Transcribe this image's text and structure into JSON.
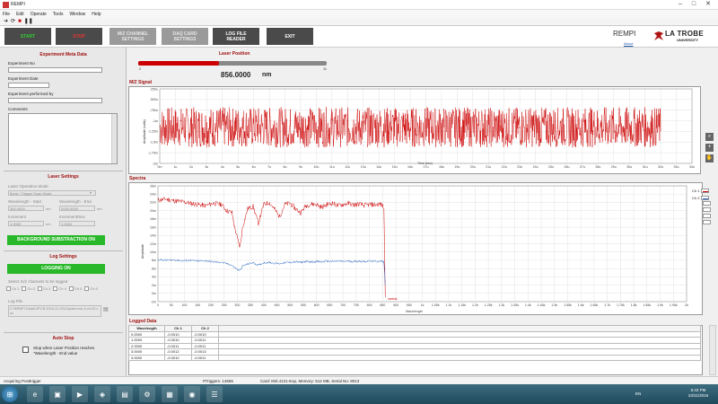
{
  "window": {
    "title": "REMPI",
    "min": "–",
    "max": "□",
    "close": "✕"
  },
  "menu": [
    "File",
    "Edit",
    "Operate",
    "Tools",
    "Window",
    "Help"
  ],
  "toolbar_icons": [
    "➜",
    "⟳",
    "■",
    "❚❚"
  ],
  "top_buttons": {
    "start": "START",
    "stop": "STOP",
    "mz": "M/Z CHANNEL\nSETTINGS",
    "daq": "DAQ CARD\nSETTINGS",
    "logfile": "LOG FILE\nREADER",
    "exit": "EXIT"
  },
  "brand": {
    "app": "REMPI",
    "about": "About",
    "logo_top": "LA TROBE",
    "logo_bottom": "UNIVERSITY"
  },
  "left": {
    "meta_title": "Experiment Meta Data",
    "exp_no": "Experiment No",
    "exp_date": "Experiment Date",
    "exp_by": "Experiment performed by",
    "comments": "Comments",
    "laser_title": "Laser Settings",
    "laser_mode_label": "Laser Operation Mode",
    "laser_mode_value": "Burst / Trigger Scan Mode",
    "wl_start_label": "Wavelength - Start",
    "wl_end_label": "Wavelength - End",
    "wl_start": "300.0000",
    "wl_end": "2000.0000",
    "nm": "nm",
    "inc_label": "Increment",
    "inc_sec_label": "Increment/Sec",
    "inc": "1.0000",
    "inc_sec": "1.0000",
    "bg_btn": "BACKGROUND SUBSTRACTION ON",
    "log_title": "Log Settings",
    "logging_btn": "LOGGING ON",
    "select_ch_label": "Select m/z channels to be logged",
    "channels": [
      "Ch 1",
      "Ch 2",
      "Ch 3",
      "Ch 4",
      "Ch 5",
      "Ch 6"
    ],
    "logfile_label": "Log File",
    "logfile_path": "C:\\REMPI Data\\LZPCB 2016-11-23\\12pulse-nov-4-ch-02.csv",
    "auto_title": "Auto Stop",
    "auto_text": "Stop when Laser Position reaches \"Wavelength - End value"
  },
  "laser": {
    "title": "Laser Position",
    "value": "856.0000",
    "unit": "nm",
    "min_label": "0",
    "max_label": "2k",
    "fraction": 0.428
  },
  "mz": {
    "title": "M/Z Signal",
    "ylabel": "Amplitude (volts)",
    "xlabel": "Time (sec)",
    "yticks": [
      "-250u",
      "-500u",
      "-750u",
      "-1m",
      "-1.25m",
      "-1.5m",
      "-1.75m",
      "-2m"
    ],
    "xticks": [
      "0m",
      "1u",
      "2u",
      "3u",
      "4u",
      "5u",
      "6u",
      "7u",
      "8u",
      "9u",
      "10u",
      "11u",
      "12u",
      "13u",
      "14u",
      "15u",
      "16u",
      "17u",
      "18u",
      "19u",
      "20u",
      "21u",
      "22u",
      "23u",
      "24u",
      "25u",
      "26u",
      "27u",
      "28u",
      "29u",
      "30u",
      "31u",
      "32u",
      "33u",
      "34u"
    ]
  },
  "spectra": {
    "title": "Spectra",
    "ylabel": "Amplitude",
    "xlabel": "Wavelength",
    "yticks": [
      "26m",
      "24m",
      "22m",
      "20m",
      "18m",
      "16m",
      "14m",
      "12m",
      "10m",
      "8m",
      "6m",
      "4m",
      "2m",
      "0m",
      "-2m"
    ],
    "xticks": [
      "0",
      "50",
      "100",
      "150",
      "200",
      "250",
      "300",
      "350",
      "400",
      "450",
      "500",
      "550",
      "600",
      "650",
      "700",
      "750",
      "800",
      "850",
      "900",
      "950",
      "1k",
      "1.05k",
      "1.1k",
      "1.15k",
      "1.2k",
      "1.25k",
      "1.3k",
      "1.35k",
      "1.4k",
      "1.45k",
      "1.5k",
      "1.55k",
      "1.6k",
      "1.65k",
      "1.7k",
      "1.75k",
      "1.8k",
      "1.85k",
      "1.9k",
      "1.95k",
      "2k"
    ],
    "legend": [
      "Ch 1",
      "Ch 2"
    ],
    "marker_label": "lumbak"
  },
  "chart_data": [
    {
      "type": "line",
      "title": "M/Z Signal",
      "xlabel": "Time (sec)",
      "ylabel": "Amplitude (volts)",
      "xlim": [
        0,
        34
      ],
      "ylim": [
        -0.002,
        -0.00025
      ],
      "series": [
        {
          "values_mean": -0.00115,
          "values_span": [
            -0.0016,
            -0.00065
          ]
        }
      ]
    },
    {
      "type": "line",
      "title": "Spectra",
      "xlabel": "Wavelength",
      "ylabel": "Amplitude",
      "xlim": [
        0,
        2000
      ],
      "ylim": [
        -0.002,
        0.026
      ],
      "x": [
        0,
        30,
        60,
        90,
        120,
        150,
        180,
        210,
        240,
        260,
        280,
        290,
        300,
        310,
        320,
        340,
        360,
        380,
        400,
        420,
        440,
        460,
        480,
        500,
        520,
        540,
        560,
        580,
        600,
        620,
        640,
        660,
        680,
        700,
        720,
        740,
        760,
        780,
        800,
        820,
        840,
        850,
        855,
        860
      ],
      "series": [
        {
          "name": "Ch 1",
          "values": [
            0.0225,
            0.0228,
            0.0224,
            0.0222,
            0.0218,
            0.0215,
            0.0212,
            0.0218,
            0.0215,
            0.02,
            0.0195,
            0.016,
            0.0135,
            0.011,
            0.016,
            0.0205,
            0.021,
            0.017,
            0.0215,
            0.022,
            0.0205,
            0.0185,
            0.0215,
            0.0218,
            0.0205,
            0.0195,
            0.0212,
            0.0216,
            0.0215,
            0.0208,
            0.0215,
            0.0218,
            0.0212,
            0.0215,
            0.0218,
            0.0214,
            0.0216,
            0.0213,
            0.0215,
            0.0214,
            0.0216,
            0.0212,
            0.0205,
            -0.001
          ]
        },
        {
          "name": "Ch 2",
          "values": [
            0.0082,
            0.008,
            0.0081,
            0.0079,
            0.008,
            0.0078,
            0.0079,
            0.0076,
            0.0075,
            0.0072,
            0.0068,
            0.0062,
            0.0058,
            0.0055,
            0.0066,
            0.0071,
            0.0074,
            0.0068,
            0.0074,
            0.0075,
            0.0073,
            0.0072,
            0.0074,
            0.0075,
            0.0076,
            0.0075,
            0.0077,
            0.0076,
            0.0077,
            0.0076,
            0.0078,
            0.0077,
            0.0078,
            0.0077,
            0.0078,
            0.0077,
            0.0078,
            0.0077,
            0.0078,
            0.0077,
            0.0078,
            0.0077,
            0.0076,
            0.002
          ]
        }
      ],
      "legend": "right"
    }
  ],
  "logged": {
    "title": "Logged Data",
    "headers": [
      "Wavelength",
      "Ch 1",
      "Ch 2"
    ],
    "rows": [
      [
        "0.0000",
        "-0.0010",
        "-0.0010"
      ],
      [
        "1.0000",
        "-0.0010",
        "-0.0011"
      ],
      [
        "2.0000",
        "-0.0011",
        "-0.0011"
      ],
      [
        "3.0000",
        "-0.0012",
        "-0.0013"
      ],
      [
        "4.0000",
        "-0.0010",
        "-0.0011"
      ]
    ]
  },
  "status": {
    "left": "Acquiring Posttrigger",
    "triggers": "#Triggers: 14555",
    "card": "Card: M3i.4121-Exp, Memory: 512 MB, Serial No: 8013"
  },
  "taskbar": {
    "lang": "EN",
    "time": "5:43 PM",
    "date": "23/11/2016"
  },
  "colors": {
    "ch1": "#cc0000",
    "ch2": "#1f5fbf",
    "accent": "#a01010",
    "green_btn": "#29b829"
  }
}
